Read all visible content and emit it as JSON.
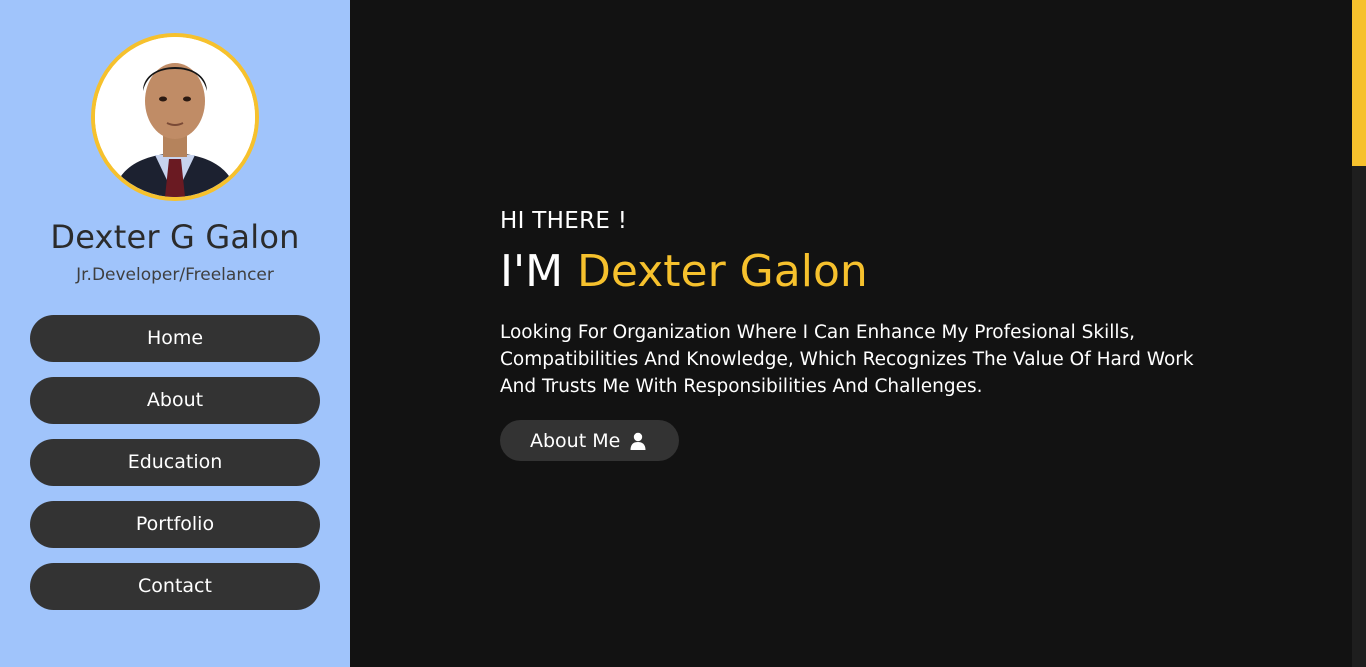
{
  "sidebar": {
    "name": "Dexter G Galon",
    "role": "Jr.Developer/Freelancer",
    "nav": [
      {
        "label": "Home"
      },
      {
        "label": "About"
      },
      {
        "label": "Education"
      },
      {
        "label": "Portfolio"
      },
      {
        "label": "Contact"
      }
    ]
  },
  "hero": {
    "greeting": "HI THERE !",
    "headline_prefix": "I'M",
    "headline_name": "Dexter Galon",
    "intro": "Looking For Organization Where I Can Enhance My Profesional Skills, Compatibilities And Knowledge, Which Recognizes The Value Of Hard Work And Trusts Me With Responsibilities And Challenges.",
    "button_label": "About Me",
    "button_icon": "user-icon"
  },
  "colors": {
    "sidebar_bg": "#a0c4fb",
    "main_bg": "#121212",
    "accent": "#f6c12d",
    "button_bg": "#333333"
  }
}
